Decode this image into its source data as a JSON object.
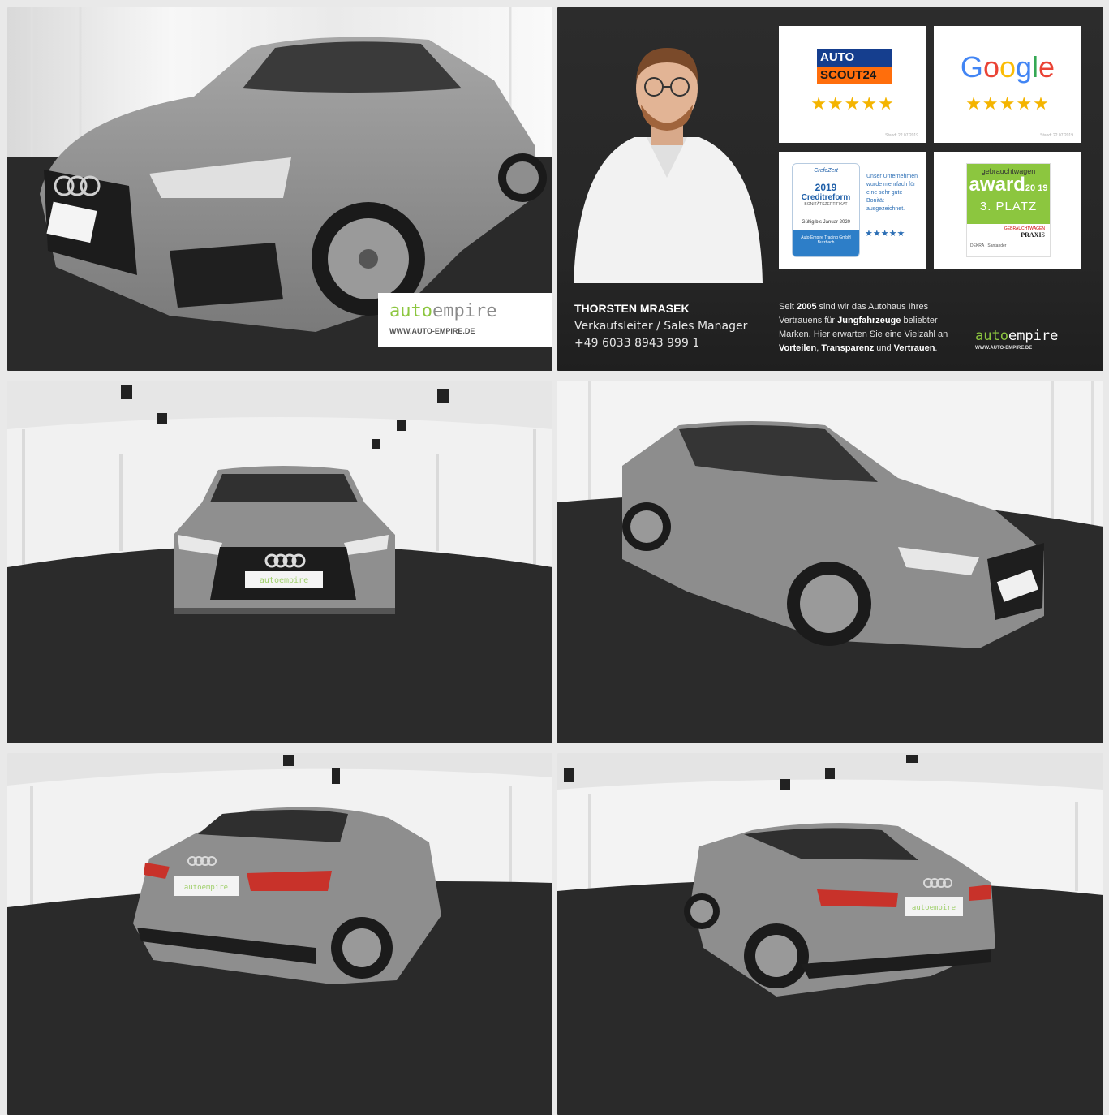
{
  "gallery": {
    "logo": {
      "part_green": "auto",
      "part_grey": "empire",
      "url": "WWW.AUTO-EMPIRE.DE"
    },
    "sales": {
      "name": "THORSTEN MRASEK",
      "role": "Verkaufsleiter / Sales Manager",
      "phone": "+49 6033 8943 999 1",
      "copy_parts": [
        "Seit ",
        "2005",
        " sind wir das Autohaus Ihres Vertrauens für ",
        "Jungfahrzeuge",
        " beliebter Marken. Hier erwarten Sie eine Vielzahl an ",
        "Vorteilen",
        ", ",
        "Transparenz",
        " und ",
        "Vertrauen",
        "."
      ]
    },
    "badges": {
      "autoscout": {
        "top": "AUTO",
        "bottom": "SCOUT24",
        "stars": "★★★★★",
        "stand": "Stand: 22.07.2019"
      },
      "google": {
        "name": "Google",
        "stars": "★★★★★",
        "stand": "Stand: 22.07.2019"
      },
      "crefo": {
        "small": "CrefoZert",
        "year": "2019",
        "name": "Creditreform",
        "sub": "BONITÄTSZERTIFIKAT",
        "valid": "Gültig bis Januar 2020",
        "foot": "Auto Empire Trading GmbH Butzbach",
        "side": "Unser Unternehmen wurde mehrfach für eine sehr gute Bonität ausgezeichnet.",
        "stars": "★★★★★"
      },
      "award": {
        "top": "gebrauchtwagen",
        "word": "award",
        "years": "20 19",
        "place": "3. PLATZ",
        "magazine": "GEBRAUCHTWAGEN",
        "praxis": "PRAXIS",
        "partners": "DEKRA  · Santander"
      }
    },
    "plate_text": "autoempire"
  }
}
